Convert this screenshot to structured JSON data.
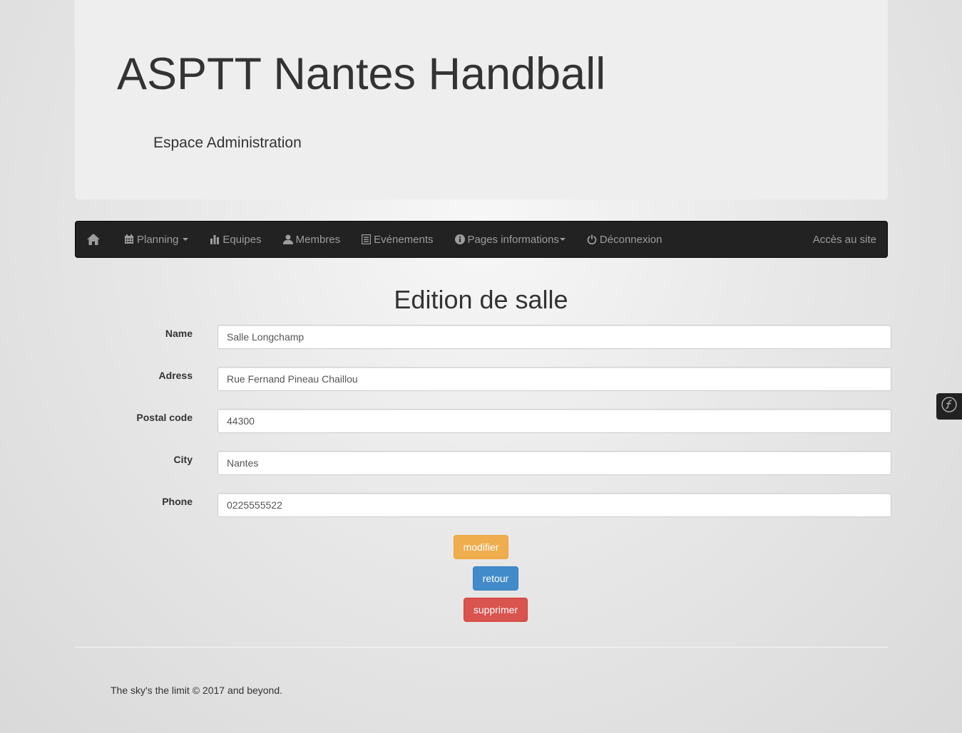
{
  "header": {
    "title": "ASPTT Nantes Handball",
    "subtitle": "Espace Administration"
  },
  "navbar": {
    "home_icon": "home-icon",
    "items": [
      {
        "label": "Planning",
        "icon": "calendar-icon",
        "dropdown": true
      },
      {
        "label": "Equipes",
        "icon": "bar-chart-icon",
        "dropdown": false
      },
      {
        "label": "Membres",
        "icon": "user-icon",
        "dropdown": false
      },
      {
        "label": "Evénements",
        "icon": "list-icon",
        "dropdown": false
      },
      {
        "label": "Pages informations",
        "icon": "info-icon",
        "dropdown": true
      },
      {
        "label": "Déconnexion",
        "icon": "power-icon",
        "dropdown": false
      }
    ],
    "right_link": "Accès au site"
  },
  "form": {
    "title": "Edition de salle",
    "fields": [
      {
        "label": "Name",
        "value": "Salle Longchamp"
      },
      {
        "label": "Adress",
        "value": "Rue Fernand Pineau Chaillou"
      },
      {
        "label": "Postal code",
        "value": "44300"
      },
      {
        "label": "City",
        "value": "Nantes"
      },
      {
        "label": "Phone",
        "value": "0225555522"
      }
    ],
    "buttons": {
      "modify": "modifier",
      "back": "retour",
      "delete": "supprimer"
    }
  },
  "footer": {
    "text": "The sky's the limit © 2017 and beyond."
  },
  "colors": {
    "navbar_bg": "#222222",
    "warning": "#f0ad4e",
    "primary": "#428bca",
    "danger": "#d9534f"
  }
}
